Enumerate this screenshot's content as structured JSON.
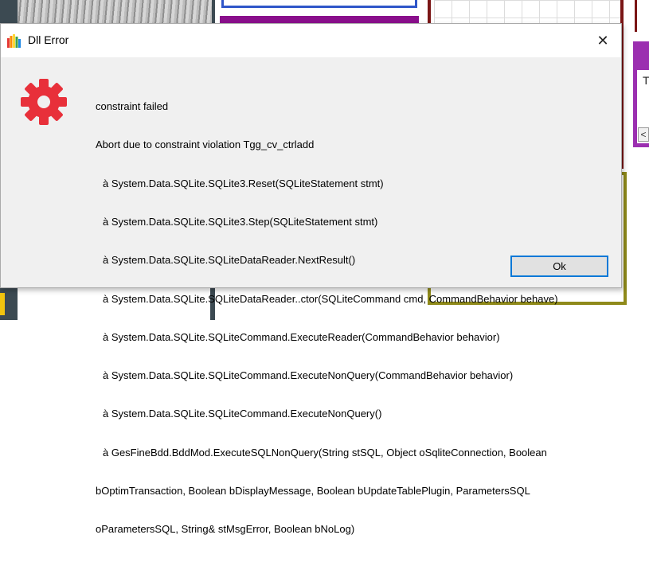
{
  "dialog": {
    "title": "Dll Error",
    "close_symbol": "✕",
    "message_lines": [
      "constraint failed",
      "Abort due to constraint violation Tgg_cv_ctrladd",
      "à System.Data.SQLite.SQLite3.Reset(SQLiteStatement stmt)",
      "à System.Data.SQLite.SQLite3.Step(SQLiteStatement stmt)",
      "à System.Data.SQLite.SQLiteDataReader.NextResult()",
      "à System.Data.SQLite.SQLiteDataReader..ctor(SQLiteCommand cmd, CommandBehavior behave)",
      "à System.Data.SQLite.SQLiteCommand.ExecuteReader(CommandBehavior behavior)",
      "à System.Data.SQLite.SQLiteCommand.ExecuteNonQuery(CommandBehavior behavior)",
      "à System.Data.SQLite.SQLiteCommand.ExecuteNonQuery()",
      "à GesFineBdd.BddMod.ExecuteSQLNonQuery(String stSQL, Object oSqliteConnection, Boolean",
      "bOptimTransaction, Boolean bDisplayMessage, Boolean bUpdateTablePlugin, ParametersSQL",
      "oParametersSQL, String& stMsgError, Boolean bNoLog)"
    ],
    "ok_label": "Ok",
    "icon": "gear-icon",
    "icon_color": "#e8303a"
  },
  "background": {
    "panel_letter": "T",
    "scroll_arrow": "<"
  },
  "colors": {
    "accent_button_border": "#0078d7",
    "background_maroon": "#7a1515",
    "background_olive": "#8f8a1a",
    "background_purple": "#9b2fb0",
    "background_blue": "#2f56c9"
  }
}
